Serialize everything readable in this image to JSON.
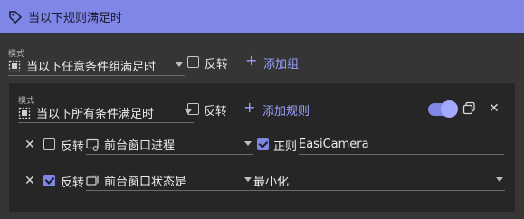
{
  "header": {
    "title": "当以下规则满足时",
    "icon": "tag-icon"
  },
  "outer": {
    "mode_label": "模式",
    "mode_value": "当以下任意条件组满足时",
    "invert_label": "反转",
    "invert_checked": false,
    "add_group_label": "添加组"
  },
  "group": {
    "mode_label": "模式",
    "mode_value": "当以下所有条件满足时",
    "invert_label": "反转",
    "invert_checked": false,
    "add_rule_label": "添加规则",
    "enabled": true,
    "rules": [
      {
        "invert_label": "反转",
        "invert_checked": false,
        "type_value": "前台窗口进程",
        "regex_label": "正则",
        "regex_checked": true,
        "value": "EasiCamera"
      },
      {
        "invert_label": "反转",
        "invert_checked": true,
        "type_value": "前台窗口状态是",
        "state_value": "最小化"
      }
    ]
  },
  "colors": {
    "accent": "#7f86e6",
    "background": "#2d2d2d",
    "panel": "#262626"
  }
}
